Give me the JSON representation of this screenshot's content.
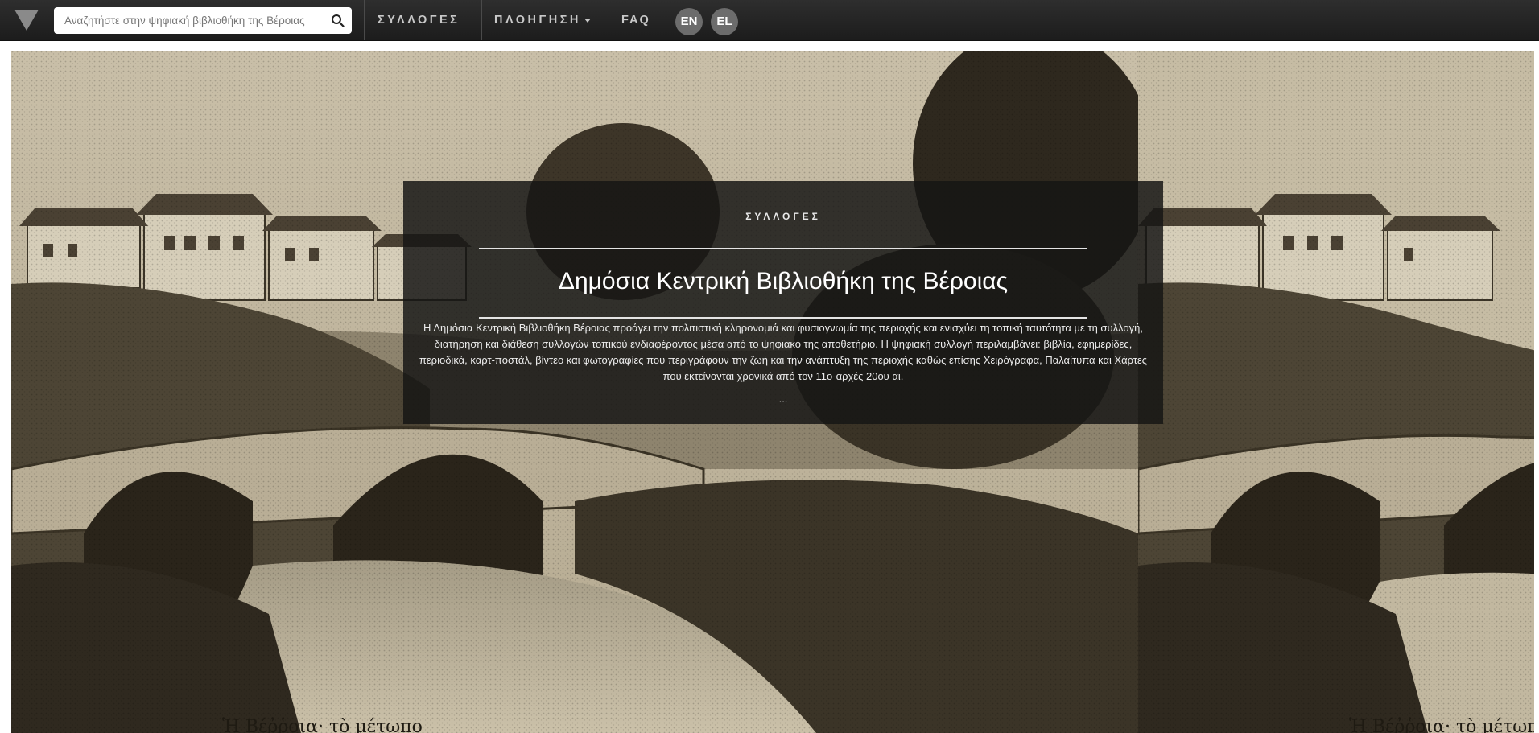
{
  "search": {
    "placeholder": "Αναζητήστε στην ψηφιακή βιβλιοθήκη της Βέροιας"
  },
  "nav": {
    "collections_label": "ΣΥΛΛΟΓΕΣ",
    "navigation_label": "ΠΛΟΗΓΗΣΗ",
    "faq_label": "FAQ",
    "lang_en": "EN",
    "lang_el": "EL"
  },
  "hero": {
    "kicker": "ΣΥΛΛΟΓΕΣ",
    "title": "Δημόσια Κεντρική Βιβλιοθήκη της Βέροιας",
    "description": "Η Δημόσια Κεντρική Βιβλιοθήκη Βέροιας προάγει την πολιτιστική κληρονομιά και φυσιογνωμία της περιοχής και ενισχύει τη τοπική ταυτότητα με τη συλλογή, διατήρηση και διάθεση συλλογών τοπικού ενδιαφέροντος μέσα από το ψηφιακό της αποθετήριο. Η ψηφιακή συλλογή περιλαμβάνει: βιβλία, εφημερίδες, περιοδικά, καρτ-ποστάλ, βίντεο και φωτογραφίες που περιγράφουν την ζωή και την ανάπτυξη της περιοχής καθώς επίσης Χειρόγραφα, Παλαίτυπα και Χάρτες που εκτείνονται χρονικά από τον 11ο-αρχές 20ου αι.",
    "more": "...",
    "caption": "Ἡ Βέῤῥοια· τὸ μέτωπο"
  },
  "colors": {
    "navbar": "#262626",
    "panel": "#161514",
    "lang_badge": "#6c6c6c",
    "sepia_light": "#c2b8a0",
    "sepia_dark": "#2f2a20"
  },
  "icons": [
    "triangle-logo-icon",
    "search-icon",
    "caret-down-icon"
  ]
}
